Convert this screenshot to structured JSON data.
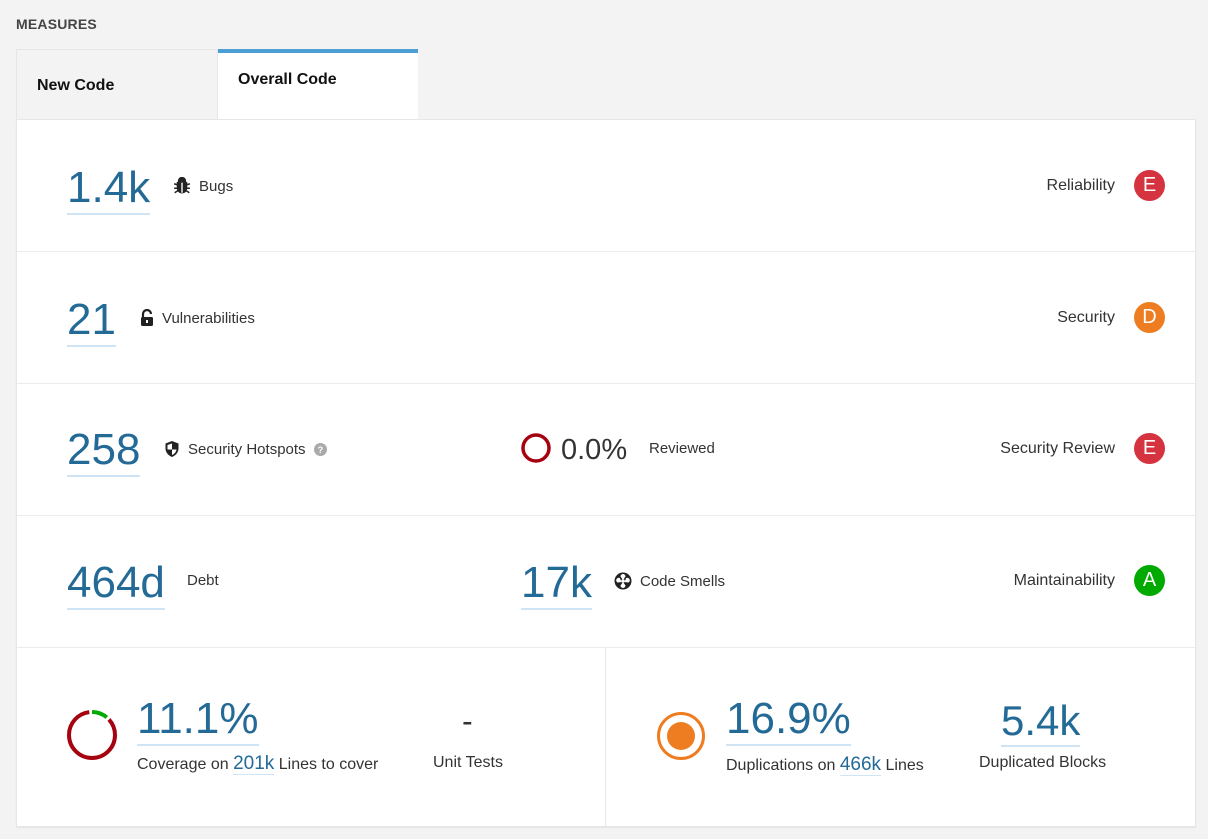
{
  "heading": "MEASURES",
  "tabs": [
    {
      "label": "New Code",
      "active": false
    },
    {
      "label": "Overall Code",
      "active": true
    }
  ],
  "colors": {
    "accent": "#4b9fd5",
    "value": "#236a97",
    "rating_E": "#d4333f",
    "rating_D": "#ed7d20",
    "rating_A": "#00aa00"
  },
  "reliability": {
    "value": "1.4k",
    "label": "Bugs",
    "icon": "bug-icon",
    "rating_label": "Reliability",
    "rating": "E"
  },
  "security": {
    "value": "21",
    "label": "Vulnerabilities",
    "icon": "lock-icon",
    "rating_label": "Security",
    "rating": "D"
  },
  "security_review": {
    "value": "258",
    "label": "Security Hotspots",
    "icon": "shield-icon",
    "help_icon": "question-icon",
    "reviewed_value": "0.0%",
    "reviewed_label": "Reviewed",
    "rating_label": "Security Review",
    "rating": "E"
  },
  "maintainability": {
    "debt_value": "464d",
    "debt_label": "Debt",
    "smells_value": "17k",
    "smells_label": "Code Smells",
    "icon": "code-smell-icon",
    "rating_label": "Maintainability",
    "rating": "A"
  },
  "coverage": {
    "value": "11.1%",
    "percent": 11.1,
    "prefix": "Coverage on",
    "lines": "201k",
    "suffix": "Lines to cover",
    "unit_tests_value": "-",
    "unit_tests_label": "Unit Tests"
  },
  "duplications": {
    "value": "16.9%",
    "prefix": "Duplications on",
    "lines": "466k",
    "suffix": "Lines",
    "blocks_value": "5.4k",
    "blocks_label": "Duplicated Blocks"
  }
}
